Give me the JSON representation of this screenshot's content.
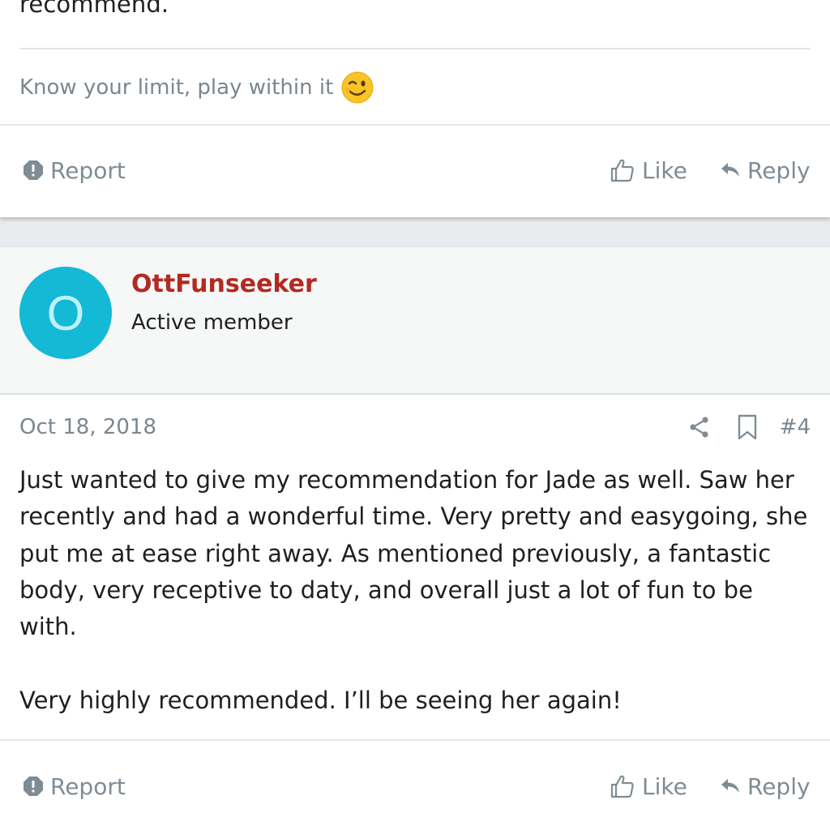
{
  "previous_post": {
    "body_tail": "recommend.",
    "signature": "Know your limit, play within it",
    "signature_emoji": "winking-face-emoji",
    "actions": {
      "report_label": "Report",
      "like_label": "Like",
      "reply_label": "Reply"
    }
  },
  "post": {
    "author": {
      "avatar_letter": "O",
      "avatar_color": "#14b9d6",
      "username": "OttFunseeker",
      "username_color": "#b22a22",
      "title": "Active member"
    },
    "date": "Oct 18, 2018",
    "number": "#4",
    "icons": [
      "share-icon",
      "bookmark-icon"
    ],
    "paragraphs": [
      "Just wanted to give my recommendation for Jade as well. Saw her recently and had a wonderful time. Very pretty and easygoing, she put me at ease right away. As mentioned previously, a fantastic body, very receptive to daty, and overall just a lot of fun to be with.",
      "Very highly recommended. I’ll be seeing her again!"
    ],
    "actions": {
      "report_label": "Report",
      "like_label": "Like",
      "reply_label": "Reply"
    }
  },
  "colors": {
    "muted_text": "#7f8c94",
    "body_text": "#1f1f1f",
    "header_bg": "#f6f7f7",
    "gap_bg": "#e7ebed"
  }
}
